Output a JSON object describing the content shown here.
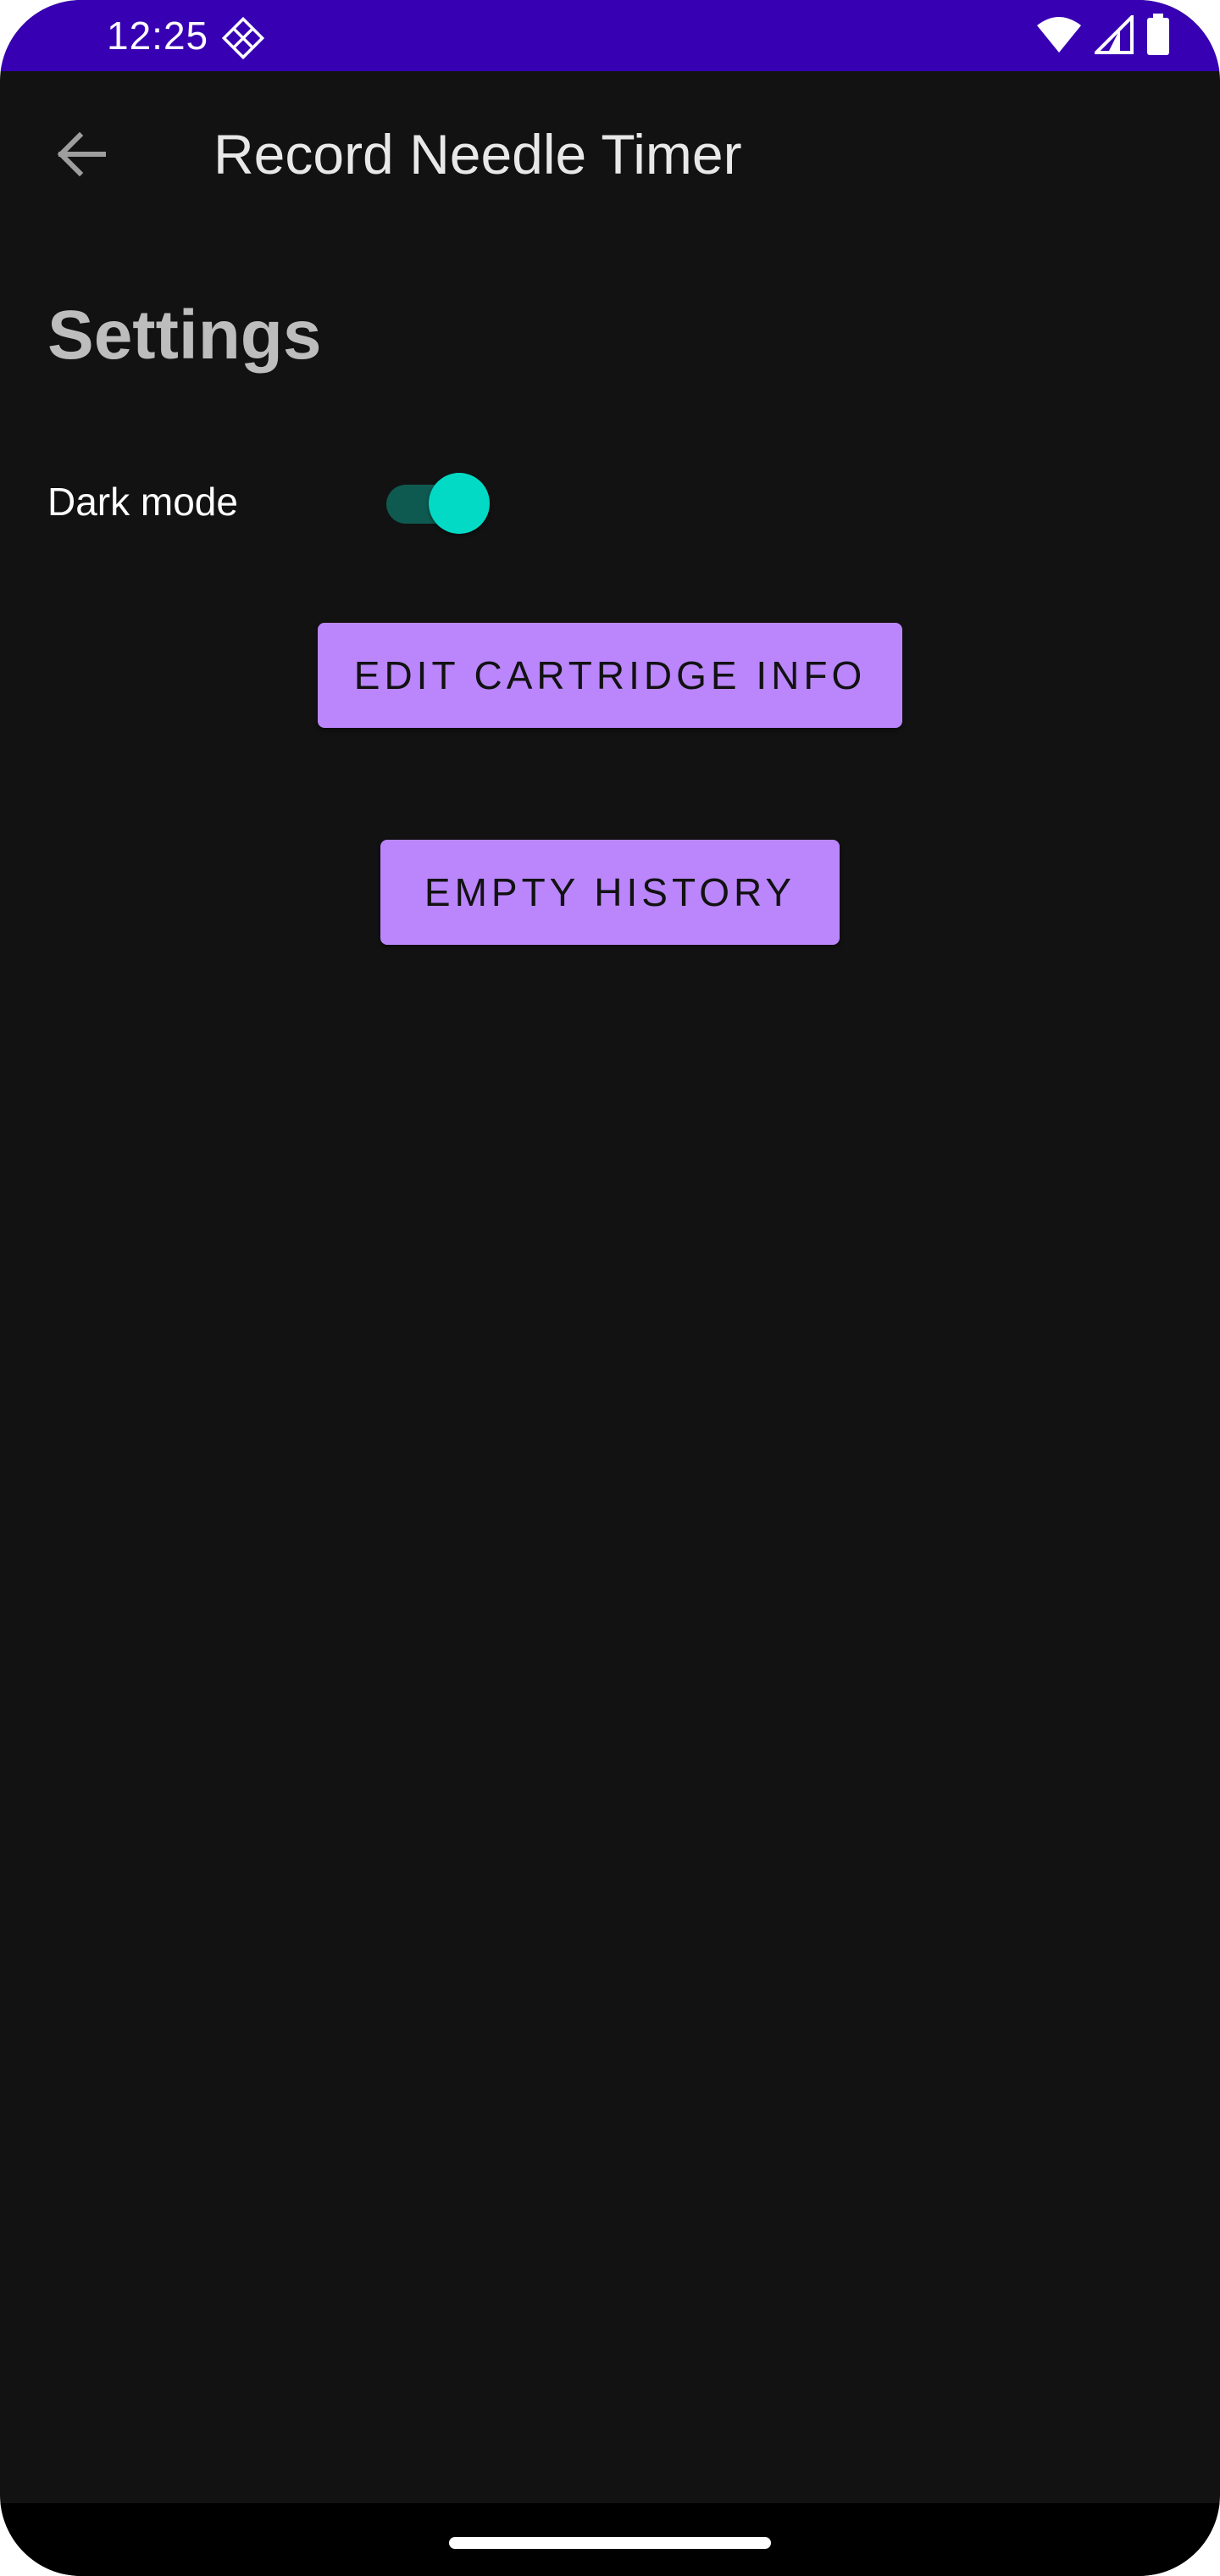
{
  "status_bar": {
    "time": "12:25",
    "app_icon": "diamond-grid-icon",
    "icons": [
      "wifi-icon",
      "cell-signal-icon",
      "battery-icon"
    ],
    "background_color": "#3700b3"
  },
  "app_bar": {
    "back_icon": "arrow-back-icon",
    "title": "Record Needle Timer"
  },
  "settings": {
    "section_title": "Settings",
    "dark_mode": {
      "label": "Dark mode",
      "enabled": true
    }
  },
  "buttons": {
    "edit_cartridge_label": "EDIT CARTRIDGE INFO",
    "empty_history_label": "EMPTY HISTORY"
  },
  "colors": {
    "background": "#121212",
    "primary": "#bb86fc",
    "secondary": "#03dac5",
    "switch_track": "#0e5a50"
  }
}
